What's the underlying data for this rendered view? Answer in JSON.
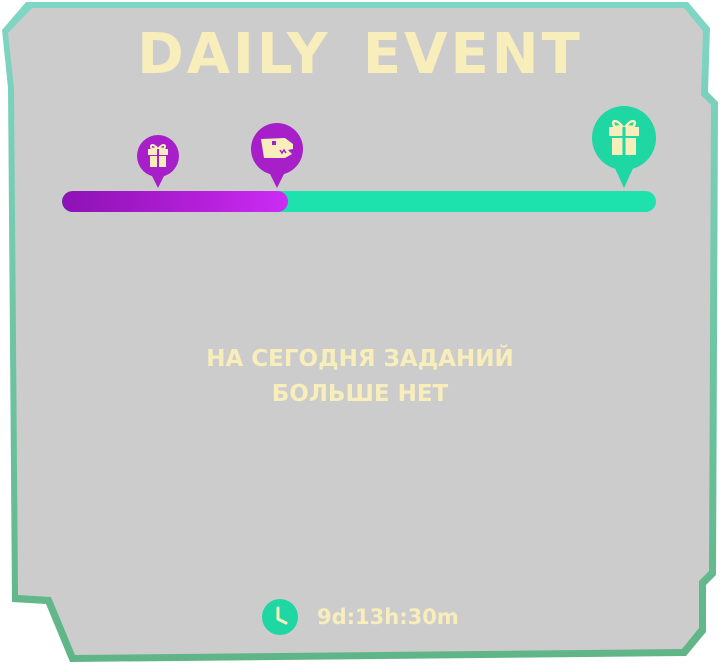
{
  "event": {
    "title": "DAILY  EVENT",
    "progress": 0.38,
    "milestones": [
      {
        "name": "gift",
        "icon": "gift-icon",
        "color": "#a61fc8",
        "reached": true
      },
      {
        "name": "dino",
        "icon": "dino-head-icon",
        "color": "#a61fc8",
        "reached": true
      },
      {
        "name": "grand-gift",
        "icon": "gift-icon",
        "color": "#1ed7a2",
        "reached": false
      }
    ]
  },
  "message": {
    "line1": "НА СЕГОДНЯ ЗАДАНИЙ",
    "line2": "БОЛЬШЕ НЕТ"
  },
  "timer": {
    "icon": "clock-icon",
    "value": "9d:13h:30m"
  },
  "colors": {
    "panel": "#cccccc",
    "border": "#6ccfb0",
    "text": "#f7eebc",
    "track_done": "#b31fd8",
    "track_remaining": "#1de2ae"
  }
}
